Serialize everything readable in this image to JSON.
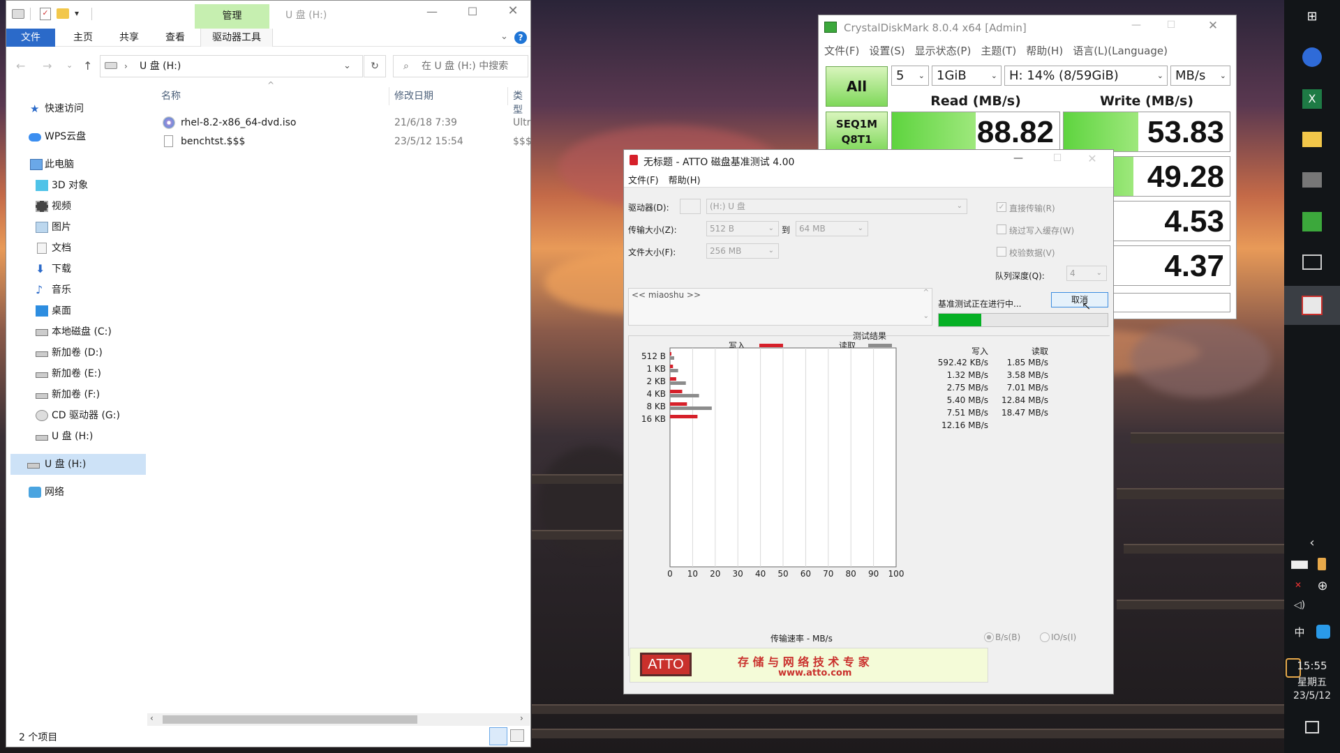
{
  "explorer": {
    "title": "U 盘 (H:)",
    "context_tab": "管理",
    "tabs": [
      "文件",
      "主页",
      "共享",
      "查看",
      "驱动器工具"
    ],
    "address": "U 盘 (H:)",
    "search_placeholder": "在 U 盘 (H:) 中搜索",
    "columns": {
      "name": "名称",
      "date": "修改日期",
      "type": "类型"
    },
    "nav": [
      {
        "label": "快速访问",
        "icon": "star-icon"
      },
      {
        "label": "WPS云盘",
        "icon": "cloud-icon"
      },
      {
        "label": "此电脑",
        "icon": "computer-icon"
      },
      {
        "label": "3D 对象",
        "icon": "cube-icon"
      },
      {
        "label": "视频",
        "icon": "video-icon"
      },
      {
        "label": "图片",
        "icon": "picture-icon"
      },
      {
        "label": "文档",
        "icon": "document-icon"
      },
      {
        "label": "下载",
        "icon": "download-icon"
      },
      {
        "label": "音乐",
        "icon": "music-icon"
      },
      {
        "label": "桌面",
        "icon": "desktop-icon"
      },
      {
        "label": "本地磁盘 (C:)",
        "icon": "drive-icon"
      },
      {
        "label": "新加卷 (D:)",
        "icon": "drive-icon"
      },
      {
        "label": "新加卷 (E:)",
        "icon": "drive-icon"
      },
      {
        "label": "新加卷 (F:)",
        "icon": "drive-icon"
      },
      {
        "label": "CD 驱动器 (G:)",
        "icon": "cd-icon"
      },
      {
        "label": "U 盘 (H:)",
        "icon": "usb-drive-icon"
      },
      {
        "label": "U 盘 (H:)",
        "icon": "usb-drive-icon"
      },
      {
        "label": "网络",
        "icon": "network-icon"
      }
    ],
    "files": [
      {
        "name": "rhel-8.2-x86_64-dvd.iso",
        "date": "21/6/18 7:39",
        "type": "Ultr",
        "icon": "disc-image-icon"
      },
      {
        "name": "benchtst.$$$",
        "date": "23/5/12 15:54",
        "type": "$$$",
        "icon": "file-icon"
      }
    ],
    "status": "2 个项目"
  },
  "cdm": {
    "title": "CrystalDiskMark 8.0.4 x64 [Admin]",
    "menu": [
      "文件(F)",
      "设置(S)",
      "显示状态(P)",
      "主题(T)",
      "帮助(H)",
      "语言(L)(Language)"
    ],
    "all_label": "All",
    "count": "5",
    "size": "1GiB",
    "drive": "H: 14% (8/59GiB)",
    "unit": "MB/s",
    "read_header": "Read (MB/s)",
    "write_header": "Write (MB/s)",
    "test1": {
      "line1": "SEQ1M",
      "line2": "Q8T1"
    },
    "read": [
      {
        "value": "88.82",
        "fill": 0.5
      }
    ],
    "write": [
      {
        "value": "53.83",
        "fill": 0.45
      },
      {
        "value": "49.28",
        "fill": 0.42
      },
      {
        "value": "4.53",
        "fill": 0.0
      },
      {
        "value": "4.37",
        "fill": 0.0
      }
    ]
  },
  "atto": {
    "title": "无标题 - ATTO 磁盘基准测试 4.00",
    "menu": [
      "文件(F)",
      "帮助(H)"
    ],
    "drive_label": "驱动器(D):",
    "drive_value": "(H:) U 盘",
    "transfer_label": "传输大小(Z):",
    "transfer_from": "512 B",
    "to_label": "到",
    "transfer_to": "64 MB",
    "filesize_label": "文件大小(F):",
    "filesize_value": "256 MB",
    "direct_io": "直接传输(R)",
    "bypass_cache": "绕过写入缓存(W)",
    "verify": "校验数据(V)",
    "queue_label": "队列深度(Q):",
    "queue_value": "4",
    "description": "<< miaoshu >>",
    "running": "基准测试正在进行中...",
    "cancel": "取消",
    "progress": 0.25,
    "results_title": "测试结果",
    "legend_write": "写入",
    "legend_read": "读取",
    "col_write": "写入",
    "col_read": "读取",
    "xlabel": "传输速率 - MB/s",
    "unit_bs": "B/s(B)",
    "unit_ios": "IO/s(I)",
    "banner_logo": "ATTO",
    "banner_text": "存 储 与 网 络 技 术 专 家",
    "banner_url": "www.atto.com"
  },
  "chart_data": {
    "type": "bar",
    "categories": [
      "512 B",
      "1 KB",
      "2 KB",
      "4 KB",
      "8 KB",
      "16 KB"
    ],
    "series": [
      {
        "name": "写入",
        "values": [
          0.59,
          1.32,
          2.75,
          5.4,
          7.51,
          12.16
        ],
        "labels": [
          "592.42 KB/s",
          "1.32 MB/s",
          "2.75 MB/s",
          "5.40 MB/s",
          "7.51 MB/s",
          "12.16 MB/s"
        ],
        "color": "#d6202a"
      },
      {
        "name": "读取",
        "values": [
          1.85,
          3.58,
          7.01,
          12.84,
          18.47,
          null
        ],
        "labels": [
          "1.85 MB/s",
          "3.58 MB/s",
          "7.01 MB/s",
          "12.84 MB/s",
          "18.47 MB/s",
          ""
        ],
        "color": "#8c8c8c"
      }
    ],
    "xlim": [
      0,
      100
    ],
    "xticks": [
      "0",
      "10",
      "20",
      "30",
      "40",
      "50",
      "60",
      "70",
      "80",
      "90",
      "100"
    ],
    "xlabel": "传输速率 - MB/s",
    "grid": true,
    "legend": "top"
  },
  "taskbar": {
    "time": "15:55",
    "weekday": "星期五",
    "date": "23/5/12",
    "ime": "中"
  }
}
